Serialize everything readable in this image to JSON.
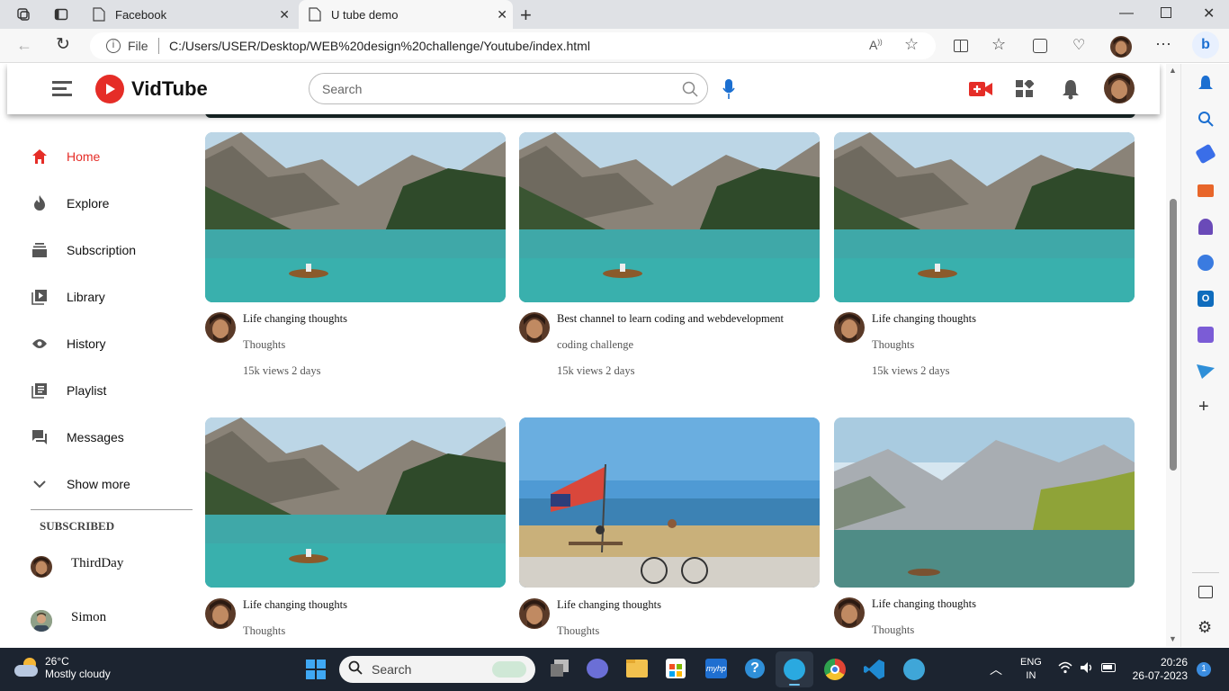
{
  "browser": {
    "tabs": [
      {
        "label": "Facebook"
      },
      {
        "label": "U tube demo"
      }
    ],
    "url_prefix": "File",
    "url": "C:/Users/USER/Desktop/WEB%20design%20challenge/Youtube/index.html"
  },
  "header": {
    "logo_text": "VidTube",
    "search_placeholder": "Search"
  },
  "sidebar": {
    "items": [
      {
        "label": "Home",
        "icon": "home-icon",
        "active": true
      },
      {
        "label": "Explore",
        "icon": "flame-icon"
      },
      {
        "label": "Subscription",
        "icon": "subscription-icon"
      },
      {
        "label": "Library",
        "icon": "library-icon"
      },
      {
        "label": "History",
        "icon": "eye-icon"
      },
      {
        "label": "Playlist",
        "icon": "playlist-icon"
      },
      {
        "label": "Messages",
        "icon": "chat-icon"
      },
      {
        "label": "Show more",
        "icon": "chevron-down-icon"
      }
    ],
    "subscribed_heading": "SUBSCRIBED",
    "subscribed": [
      {
        "name": "ThirdDay"
      },
      {
        "name": "Simon"
      }
    ]
  },
  "videos": [
    {
      "title": "Life changing thoughts",
      "channel": "Thoughts",
      "stats": "15k views 2 days",
      "thumb": "lake"
    },
    {
      "title": "Best channel to learn coding and webdevelopment",
      "channel": "coding challenge",
      "stats": "15k views 2 days",
      "thumb": "lake"
    },
    {
      "title": "Life changing thoughts",
      "channel": "Thoughts",
      "stats": "15k views 2 days",
      "thumb": "lake"
    },
    {
      "title": "Life changing thoughts",
      "channel": "Thoughts",
      "stats": "",
      "thumb": "lake"
    },
    {
      "title": "Life changing thoughts",
      "channel": "Thoughts",
      "stats": "",
      "thumb": "beach"
    },
    {
      "title": "Life changing thoughts",
      "channel": "Thoughts",
      "stats": "",
      "thumb": "mountain"
    }
  ],
  "taskbar": {
    "weather_temp": "26°C",
    "weather_desc": "Mostly cloudy",
    "search_label": "Search",
    "lang_top": "ENG",
    "lang_bottom": "IN",
    "time": "20:26",
    "date": "26-07-2023",
    "notif_count": "1"
  },
  "colors": {
    "accent_red": "#e52d27",
    "taskbar_bg": "#1c2430"
  }
}
